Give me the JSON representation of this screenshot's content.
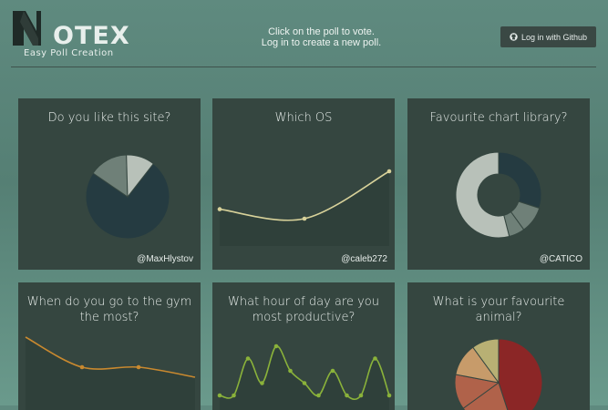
{
  "brand": {
    "name": "OTEX",
    "tagline": "Easy Poll Creation"
  },
  "header": {
    "line1": "Click on the poll to vote.",
    "line2": "Log in to create a new poll."
  },
  "login_button": {
    "label": "Log in with Github",
    "icon": "github-icon"
  },
  "colors": {
    "page_bg": "#5f8a7f",
    "card_bg": "#354640",
    "pie_dark": "#253b41",
    "pie_mid": "#6f8078",
    "pie_light": "#b8c1b9",
    "line_cream": "#d8d29a",
    "line_orange": "#c9892f",
    "line_green": "#8ab23a",
    "pie_red": "#8b2626",
    "pie_salmon": "#b0624a",
    "pie_tan": "#c79b6a",
    "pie_olive": "#b8b074"
  },
  "polls": [
    {
      "title": "Do you like this site?",
      "author": "@MaxHlystov",
      "chart_data": {
        "type": "pie",
        "values": [
          74,
          15,
          11
        ]
      }
    },
    {
      "title": "Which OS",
      "author": "@caleb272",
      "chart_data": {
        "type": "line",
        "values": [
          1,
          0,
          5
        ]
      }
    },
    {
      "title": "Favourite chart library?",
      "author": "@CATICO",
      "chart_data": {
        "type": "pie",
        "values": [
          30,
          10,
          6,
          54
        ]
      }
    },
    {
      "title": "When do you go to the gym the most?",
      "author": "",
      "chart_data": {
        "type": "line",
        "values": [
          5,
          2,
          2,
          1
        ]
      }
    },
    {
      "title": "What hour of day are you most productive?",
      "author": "",
      "chart_data": {
        "type": "line",
        "values": [
          0,
          0,
          3,
          1,
          4,
          2,
          1,
          0,
          2,
          0,
          0,
          3,
          0
        ]
      }
    },
    {
      "title": "What is your favourite animal?",
      "author": "",
      "chart_data": {
        "type": "pie",
        "values": [
          45,
          20,
          13,
          12,
          10
        ]
      }
    }
  ]
}
